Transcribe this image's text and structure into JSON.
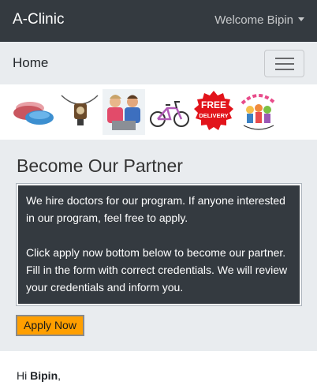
{
  "navbar": {
    "brand": "A-Clinic",
    "welcome": "Welcome Bipin"
  },
  "subnav": {
    "home": "Home"
  },
  "image_strip": {
    "items": [
      "bowls-icon",
      "lantern-icon",
      "people-icon",
      "bicycle-icon",
      "free-delivery-badge-icon",
      "child-care-logo-icon"
    ],
    "badge_text_1": "FREE",
    "badge_text_2": "DELIVERY"
  },
  "partner": {
    "title": "Become Our Partner",
    "paragraph1": "We hire doctors for our program. If anyone interested in our program, feel free to apply.",
    "paragraph2": "Click apply now bottom below to become our partner. Fill in the form with correct credentials. We will review your credentials and inform you.",
    "apply_label": "Apply Now"
  },
  "greeting": {
    "prefix": "Hi ",
    "name": "Bipin",
    "suffix": ","
  },
  "colors": {
    "topbar": "#343a40",
    "subnav": "#e9ecef",
    "apply_button": "#ff9f00"
  }
}
